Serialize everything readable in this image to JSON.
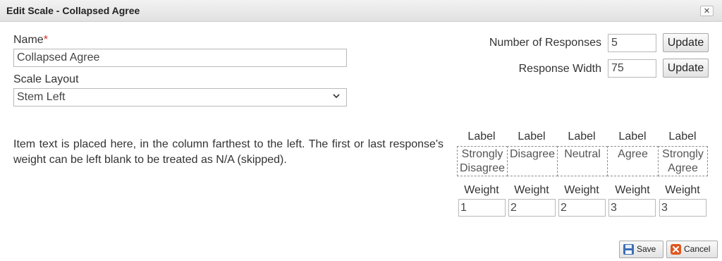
{
  "dialog": {
    "title": "Edit Scale - Collapsed Agree",
    "close_symbol": "✕"
  },
  "name": {
    "label": "Name",
    "required_mark": "*",
    "value": "Collapsed Agree"
  },
  "scale_layout": {
    "label": "Scale Layout",
    "selected": "Stem Left"
  },
  "number_of_responses": {
    "label": "Number of Responses",
    "value": "5",
    "button": "Update"
  },
  "response_width": {
    "label": "Response Width",
    "value": "75",
    "button": "Update"
  },
  "description": "Item text is placed here, in the column farthest to the left. The first or last response's weight can be left blank to be treated as N/A (skipped).",
  "responses": [
    {
      "label_header": "Label",
      "label": "Strongly Disagree",
      "weight_header": "Weight",
      "weight": "1"
    },
    {
      "label_header": "Label",
      "label": "Disagree",
      "weight_header": "Weight",
      "weight": "2"
    },
    {
      "label_header": "Label",
      "label": "Neutral",
      "weight_header": "Weight",
      "weight": "2"
    },
    {
      "label_header": "Label",
      "label": "Agree",
      "weight_header": "Weight",
      "weight": "3"
    },
    {
      "label_header": "Label",
      "label": "Strongly Agree",
      "weight_header": "Weight",
      "weight": "3"
    }
  ],
  "footer": {
    "save": "Save",
    "cancel": "Cancel"
  },
  "colors": {
    "required": "#d32f2f",
    "cancel_icon": "#e0561e",
    "save_icon": "#3d6fb6"
  }
}
